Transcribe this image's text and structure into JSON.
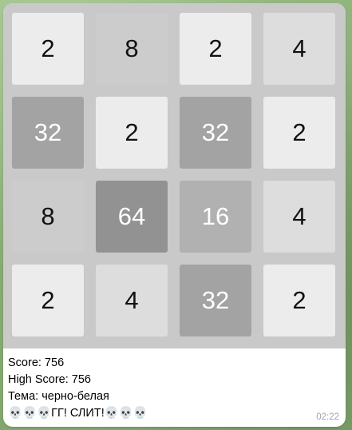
{
  "board": {
    "rows": [
      [
        "2",
        "8",
        "2",
        "4"
      ],
      [
        "32",
        "2",
        "32",
        "2"
      ],
      [
        "8",
        "64",
        "16",
        "4"
      ],
      [
        "2",
        "4",
        "32",
        "2"
      ]
    ],
    "colors": {
      "2": {
        "bg": "#ececec",
        "fg": "#111111"
      },
      "4": {
        "bg": "#dddddd",
        "fg": "#111111"
      },
      "8": {
        "bg": "#cccccc",
        "fg": "#111111"
      },
      "16": {
        "bg": "#b1b1b1",
        "fg": "#ffffff"
      },
      "32": {
        "bg": "#a3a3a3",
        "fg": "#ffffff"
      },
      "64": {
        "bg": "#929292",
        "fg": "#ffffff"
      }
    }
  },
  "message": {
    "score": "Score: 756",
    "high_score": "High Score: 756",
    "theme": "Тема: черно-белая",
    "status": "💀💀💀ГГ! СЛИТ!💀💀💀",
    "time": "02:22"
  }
}
